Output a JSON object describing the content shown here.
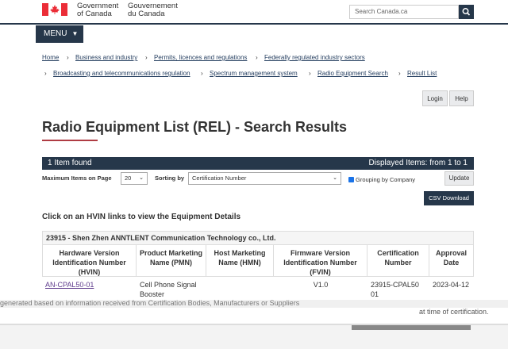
{
  "header": {
    "gov_en_line1": "Government",
    "gov_en_line2": "of Canada",
    "gov_fr_line1": "Gouvernement",
    "gov_fr_line2": "du Canada",
    "search_placeholder": "Search Canada.ca",
    "menu_label": "MENU",
    "colors": {
      "primary": "#26374a",
      "flag_red": "#eb2d37"
    }
  },
  "breadcrumbs": {
    "row1": [
      "Home",
      "Business and industry",
      "Permits, licences and regulations",
      "Federally regulated industry sectors"
    ],
    "row2": [
      "Broadcasting and telecommunications regulation",
      "Spectrum management system",
      "Radio Equipment Search",
      "Result List"
    ]
  },
  "auth": {
    "login": "Login",
    "help": "Help"
  },
  "page_title": "Radio Equipment List (REL) - Search Results",
  "results_bar": {
    "found": "1 Item found",
    "displayed": "Displayed Items: from 1 to 1"
  },
  "controls": {
    "max_items_label": "Maximum Items on Page",
    "max_items_value": "20",
    "sorting_label": "Sorting by",
    "sorting_value": "Certification Number",
    "grouping_label": "Grouping by Company",
    "grouping_checked": true,
    "update_label": "Update",
    "csv_label": "CSV Download"
  },
  "click_info": "Click on an HVIN links to view the Equipment Details",
  "table": {
    "company": "23915 - Shen Zhen ANNTLENT Communication Technology co., Ltd.",
    "headers": [
      "Hardware Version Identification Number (HVIN)",
      "Product Marketing Name (PMN)",
      "Host Marketing Name (HMN)",
      "Firmware Version Identification Number (FVIN)",
      "Certification Number",
      "Approval Date"
    ],
    "rows": [
      {
        "hvin": "AN-CPAL50-01",
        "pmn": "Cell Phone Signal Booster",
        "hmn": "",
        "fvin": "V1.0",
        "cert": "23915-CPAL5001",
        "date": "2023-04-12"
      }
    ]
  },
  "footer": {
    "generated_text": "generated based on information received from Certification Bodies, Manufacturers or Suppliers",
    "cert_time_text": "at time of certification."
  }
}
